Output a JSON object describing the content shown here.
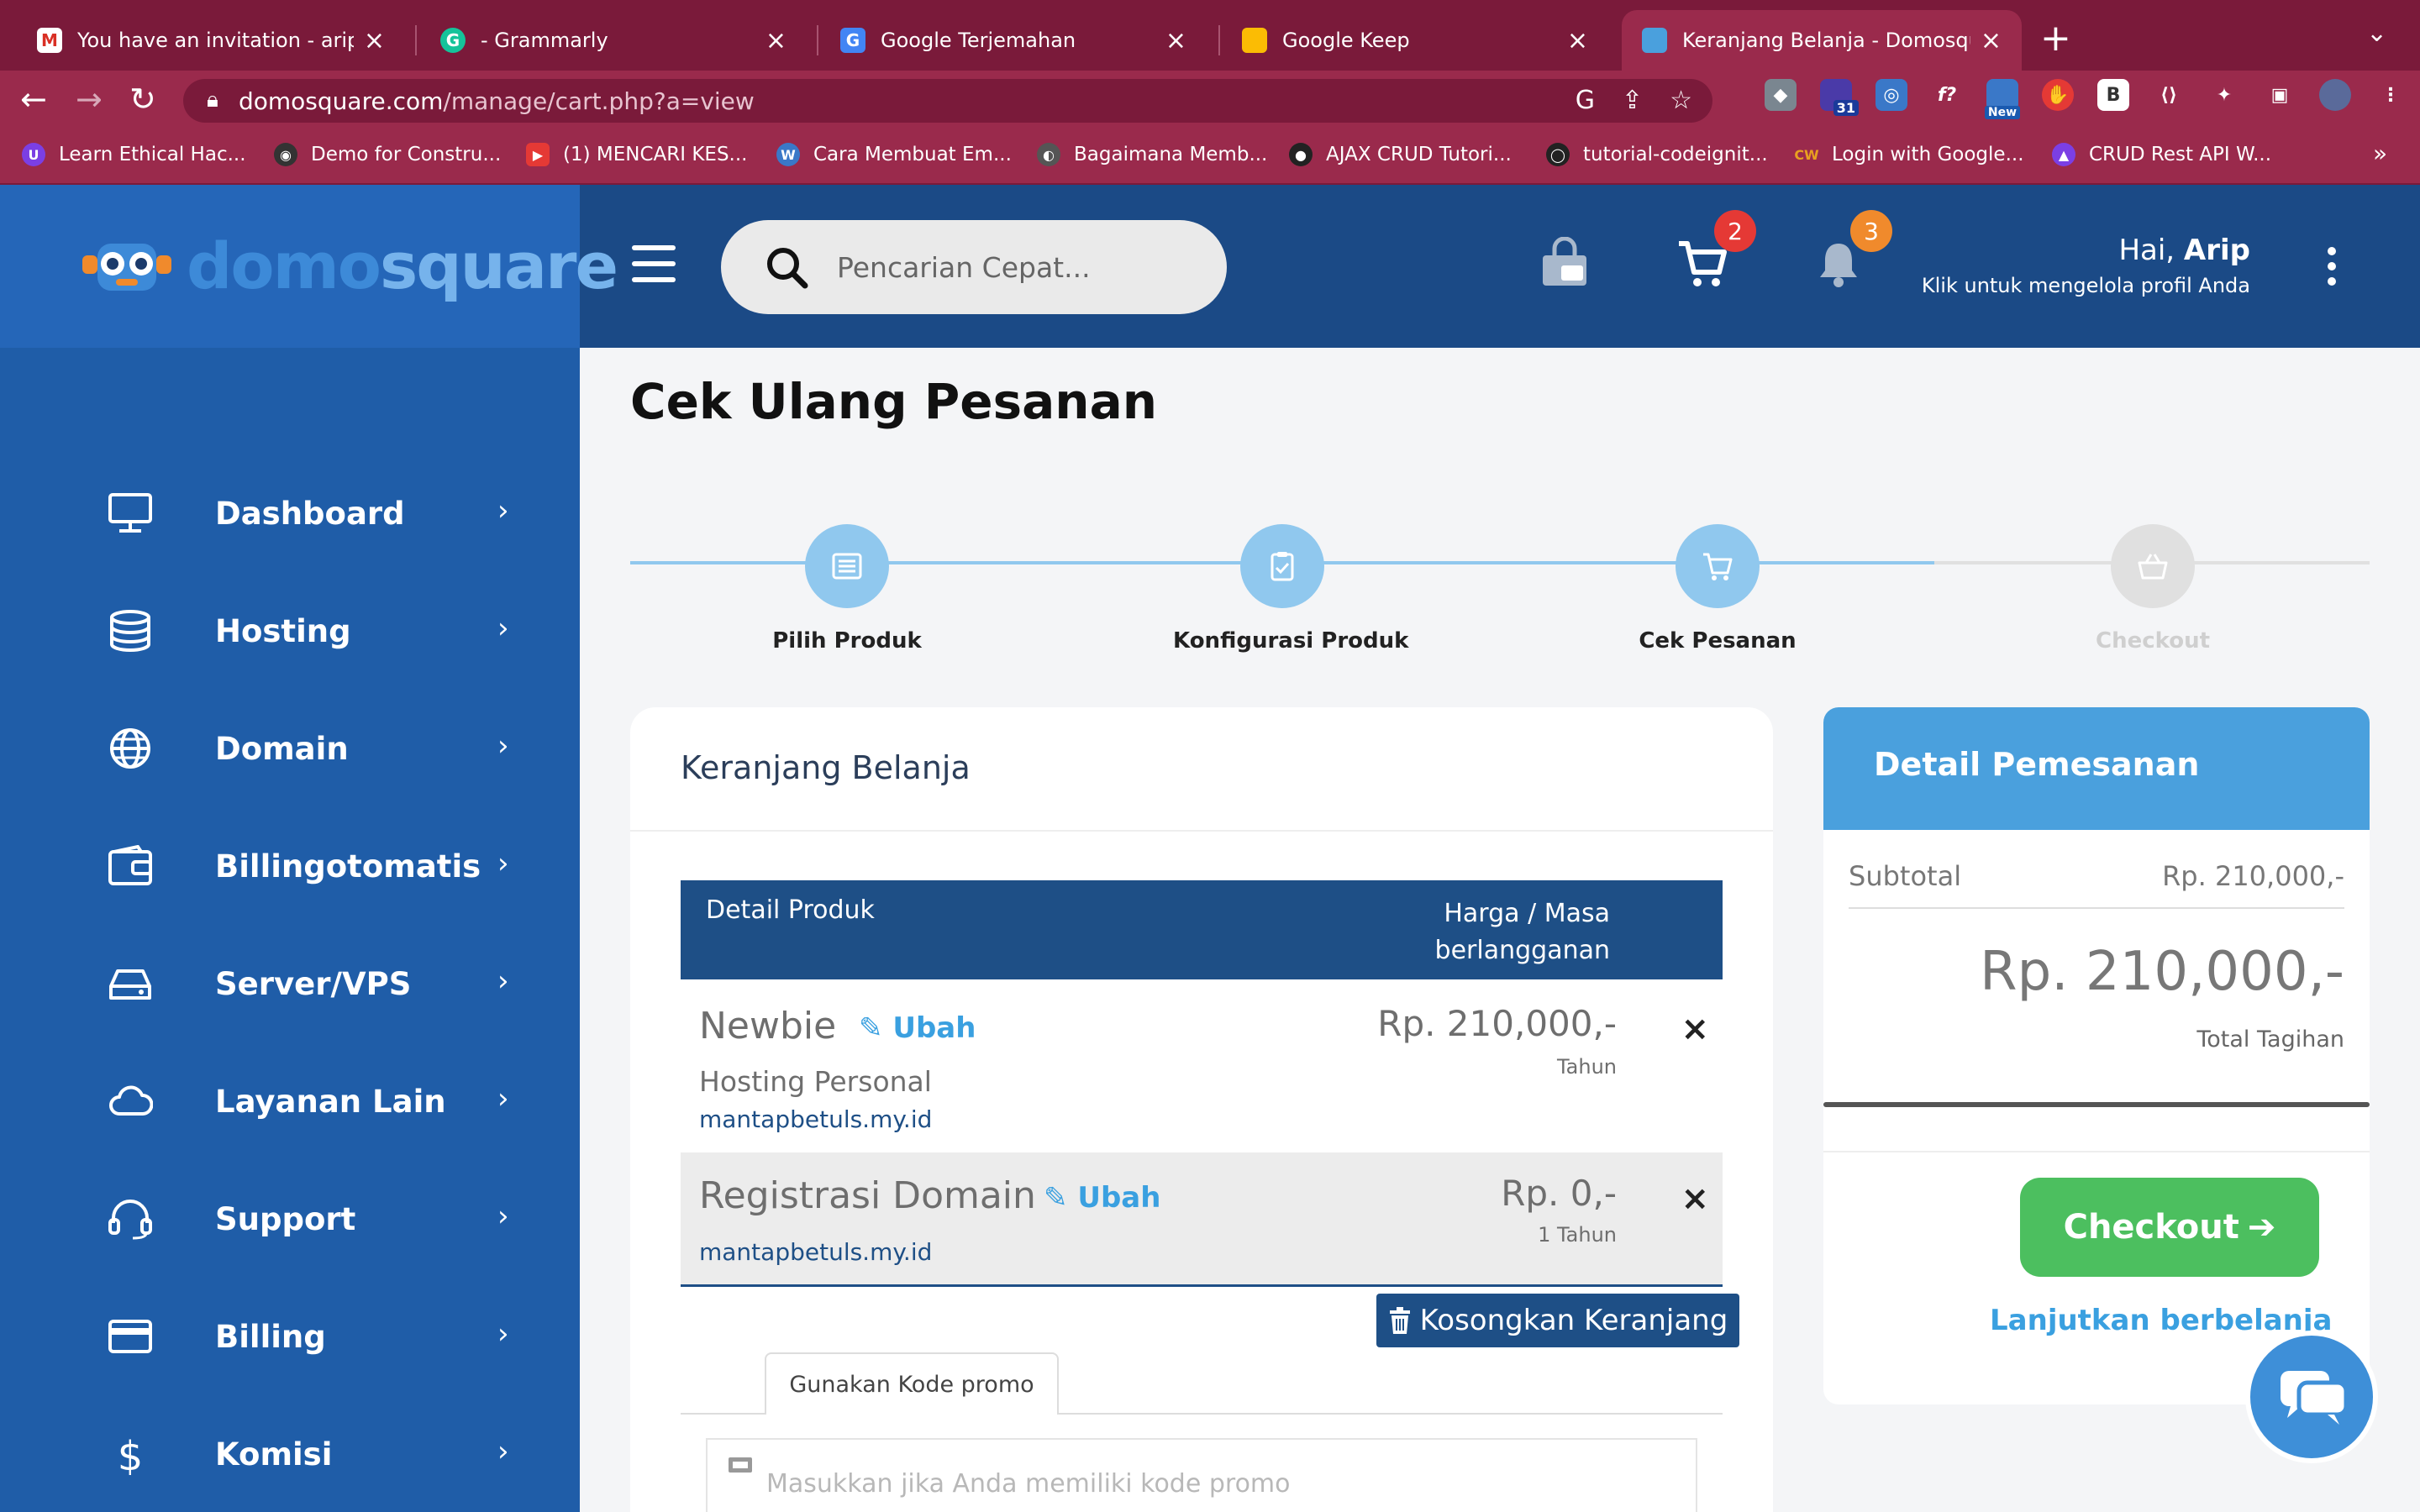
{
  "browser": {
    "tabs": [
      {
        "title": "You have an invitation - arip",
        "favicon": "gmail-icon"
      },
      {
        "title": "- Grammarly",
        "favicon": "grammarly-icon"
      },
      {
        "title": "Google Terjemahan",
        "favicon": "translate-icon"
      },
      {
        "title": "Google Keep",
        "favicon": "keep-icon"
      },
      {
        "title": "Keranjang Belanja - Domosquare",
        "favicon": "domosquare-icon"
      }
    ],
    "url_host": "domosquare.com",
    "url_path": "/manage/cart.php?a=view",
    "extension_badge_count": "31",
    "extension_new_label": "New",
    "bookmarks": [
      "Learn Ethical Hac...",
      "Demo for Constru...",
      "(1) MENCARI KES...",
      "Cara Membuat Em...",
      "Bagaimana Memb...",
      "AJAX CRUD Tutori...",
      "tutorial-codeignit...",
      "Login with Google...",
      "CRUD Rest API W..."
    ],
    "colors": {
      "frame": "#7a1a3a",
      "toolbar": "#9a2a4c"
    }
  },
  "header": {
    "logo_part1": "domo",
    "logo_part2": "square",
    "search_placeholder": "Pencarian Cepat...",
    "cart_count": "2",
    "notif_count": "3",
    "greeting_prefix": "Hai, ",
    "greeting_name": "Arip",
    "profile_hint": "Klik untuk mengelola profil Anda"
  },
  "sidebar": {
    "items": [
      {
        "label": "Dashboard",
        "icon": "monitor-icon"
      },
      {
        "label": "Hosting",
        "icon": "database-icon"
      },
      {
        "label": "Domain",
        "icon": "globe-icon"
      },
      {
        "label": "Billingotomatis",
        "icon": "wallet-icon"
      },
      {
        "label": "Server/VPS",
        "icon": "harddrive-icon"
      },
      {
        "label": "Layanan Lain",
        "icon": "cloud-icon"
      },
      {
        "label": "Support",
        "icon": "headset-icon"
      },
      {
        "label": "Billing",
        "icon": "credit-card-icon"
      },
      {
        "label": "Komisi",
        "icon": "dollar-icon"
      }
    ]
  },
  "page": {
    "title": "Cek Ulang Pesanan",
    "steps": [
      {
        "label": "Pilih Produk",
        "done": true
      },
      {
        "label": "Konfigurasi Produk",
        "done": true
      },
      {
        "label": "Cek Pesanan",
        "done": true
      },
      {
        "label": "Checkout",
        "done": false
      }
    ]
  },
  "cart": {
    "title": "Keranjang Belanja",
    "col_product": "Detail Produk",
    "col_price": "Harga / Masa berlangganan",
    "items": [
      {
        "name": "Newbie",
        "edit_label": "Ubah",
        "group": "Hosting Personal",
        "domain": "mantapbetuls.my.id",
        "price": "Rp. 210,000,-",
        "period": "Tahun"
      },
      {
        "name": "Registrasi Domain",
        "edit_label": "Ubah",
        "domain": "mantapbetuls.my.id",
        "price": "Rp. 0,-",
        "period": "1 Tahun"
      }
    ],
    "empty_label": "Kosongkan Keranjang",
    "promo_tab": "Gunakan Kode promo",
    "promo_placeholder": "Masukkan jika Anda memiliki kode promo"
  },
  "summary": {
    "title": "Detail Pemesanan",
    "subtotal_label": "Subtotal",
    "subtotal_value": "Rp. 210,000,-",
    "total_value": "Rp. 210,000,-",
    "total_label": "Total Tagihan",
    "checkout_label": "Checkout",
    "continue_label": "Lanjutkan berbelanja"
  },
  "colors": {
    "brand_dark": "#1e4f86",
    "brand_light": "#4aa0dd",
    "sidebar": "#1f5da8",
    "checkout": "#4cbf5f",
    "badge_red": "#e53935",
    "badge_orange": "#f08a2c",
    "step_active": "#90c8ee",
    "step_inactive": "#e0e0e0"
  }
}
